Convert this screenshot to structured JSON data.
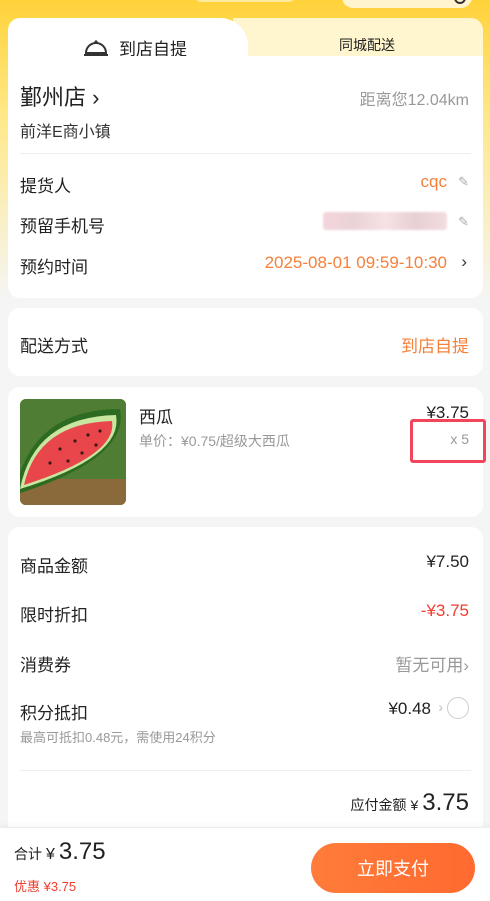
{
  "tabs": {
    "pickup": "到店自提",
    "delivery": "同城配送"
  },
  "store": {
    "name": "鄞州店",
    "distance": "距离您12.04km",
    "address": "前洋E商小镇"
  },
  "pickup_info": {
    "person_label": "提货人",
    "person_value": "cqc",
    "phone_label": "预留手机号",
    "time_label": "预约时间",
    "time_value": "2025-08-01 09:59-10:30"
  },
  "delivery": {
    "label": "配送方式",
    "value": "到店自提"
  },
  "product": {
    "name": "西瓜",
    "subtitle": "单价：¥0.75/超级大西瓜",
    "price": "¥3.75",
    "qty": "x 5"
  },
  "summary": {
    "amount_label": "商品金额",
    "amount_value": "¥7.50",
    "discount_label": "限时折扣",
    "discount_value": "-¥3.75",
    "coupon_label": "消费券",
    "coupon_value": "暂无可用",
    "points_label": "积分抵扣",
    "points_value": "¥0.48",
    "points_hint": "最高可抵扣0.48元，需使用24积分",
    "due_label": "应付金额",
    "due_currency": "¥",
    "due_value": "3.75"
  },
  "footer": {
    "total_label": "合计",
    "total_currency": "¥",
    "total_value": "3.75",
    "discount_text": "优惠 ¥3.75",
    "pay_label": "立即支付"
  },
  "colors": {
    "accent": "#f5813b",
    "red": "#f03e2f",
    "brand_yellow": "#ffd23a"
  }
}
